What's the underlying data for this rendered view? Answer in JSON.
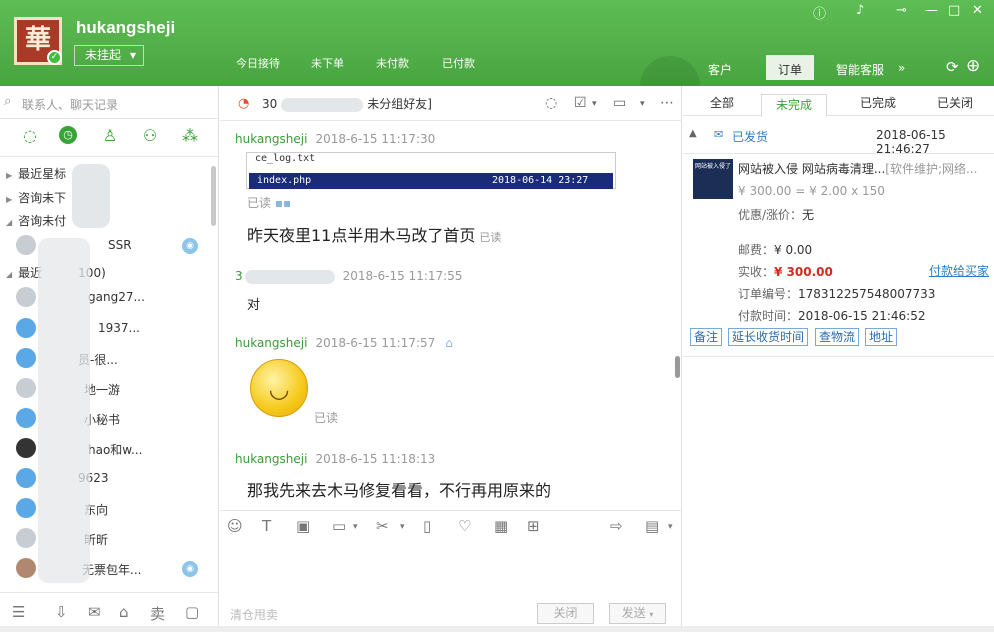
{
  "header": {
    "app_logo_text": "華",
    "username": "hukangsheji",
    "status": "未挂起",
    "tabs": [
      "今日接待",
      "未下单",
      "未付款",
      "已付款"
    ],
    "right_tabs": [
      "客户",
      "订单",
      "智能客服"
    ],
    "more": "»"
  },
  "sidebar": {
    "search_placeholder": "联系人、聊天记录",
    "groups": [
      {
        "label": "最近星标"
      },
      {
        "label": "咨询未下",
        "suffix": ")"
      },
      {
        "label": "咨询未付"
      }
    ],
    "recent_label": "最近",
    "recent_count": "100)",
    "contacts": [
      "SSR",
      "gang27...",
      "1937...",
      "员-很...",
      "地一游",
      "小秘书",
      "hao和w...",
      "9623",
      "东向",
      "昕昕",
      "无票包年..."
    ]
  },
  "chat": {
    "contact_name_prefix": "30",
    "contact_name_suffix": "未分组好友]",
    "messages": [
      {
        "sender": "hukangsheji",
        "time": "2018-6-15 11:17:30",
        "file_row_name": "index.php",
        "file_row_time": "2018-06-14 23:27",
        "file_row_prev": "ce_log.txt",
        "read_label": "已读",
        "text": "昨天夜里11点半用木马改了首页",
        "text_read": "已读"
      },
      {
        "sender": "3",
        "time": "2018-6-15 11:17:55",
        "text": "对"
      },
      {
        "sender": "hukangsheji",
        "time": "2018-6-15 11:17:57",
        "read_label": "已读"
      },
      {
        "sender": "hukangsheji",
        "time": "2018-6-15 11:18:13",
        "text": "那我先来去木马修复看看，不行再用原来的"
      }
    ],
    "input_placeholder": "清仓甩卖",
    "close_button": "关闭",
    "send_button": "发送"
  },
  "order": {
    "tabs": [
      "全部",
      "未完成",
      "已完成",
      "已关闭"
    ],
    "status": "已发货",
    "created": "2018-06-15 21:46:27",
    "product_title": "网站被入侵 网站病毒清理...",
    "product_tag": "[软件维护;网络...",
    "product_thumb_text": "网站被入侵了",
    "price_line": "¥ 300.00 = ¥ 2.00 x 150",
    "discount_label": "优惠/涨价：",
    "discount_value": "无",
    "shipping_label": "邮费：",
    "shipping_value": "¥ 0.00",
    "paid_label": "实收：",
    "paid_value": "¥ 300.00",
    "order_no_label": "订单编号：",
    "order_no_value": "178312257548007733",
    "pay_time_label": "付款时间：",
    "pay_time_value": "2018-06-15 21:46:52",
    "pay_link": "付款给买家",
    "actions": [
      "备注",
      "延长收货时间",
      "查物流",
      "地址"
    ]
  },
  "colors": {
    "brand": "#48a43f",
    "price": "#d42a1f",
    "link": "#2f7cc9"
  }
}
